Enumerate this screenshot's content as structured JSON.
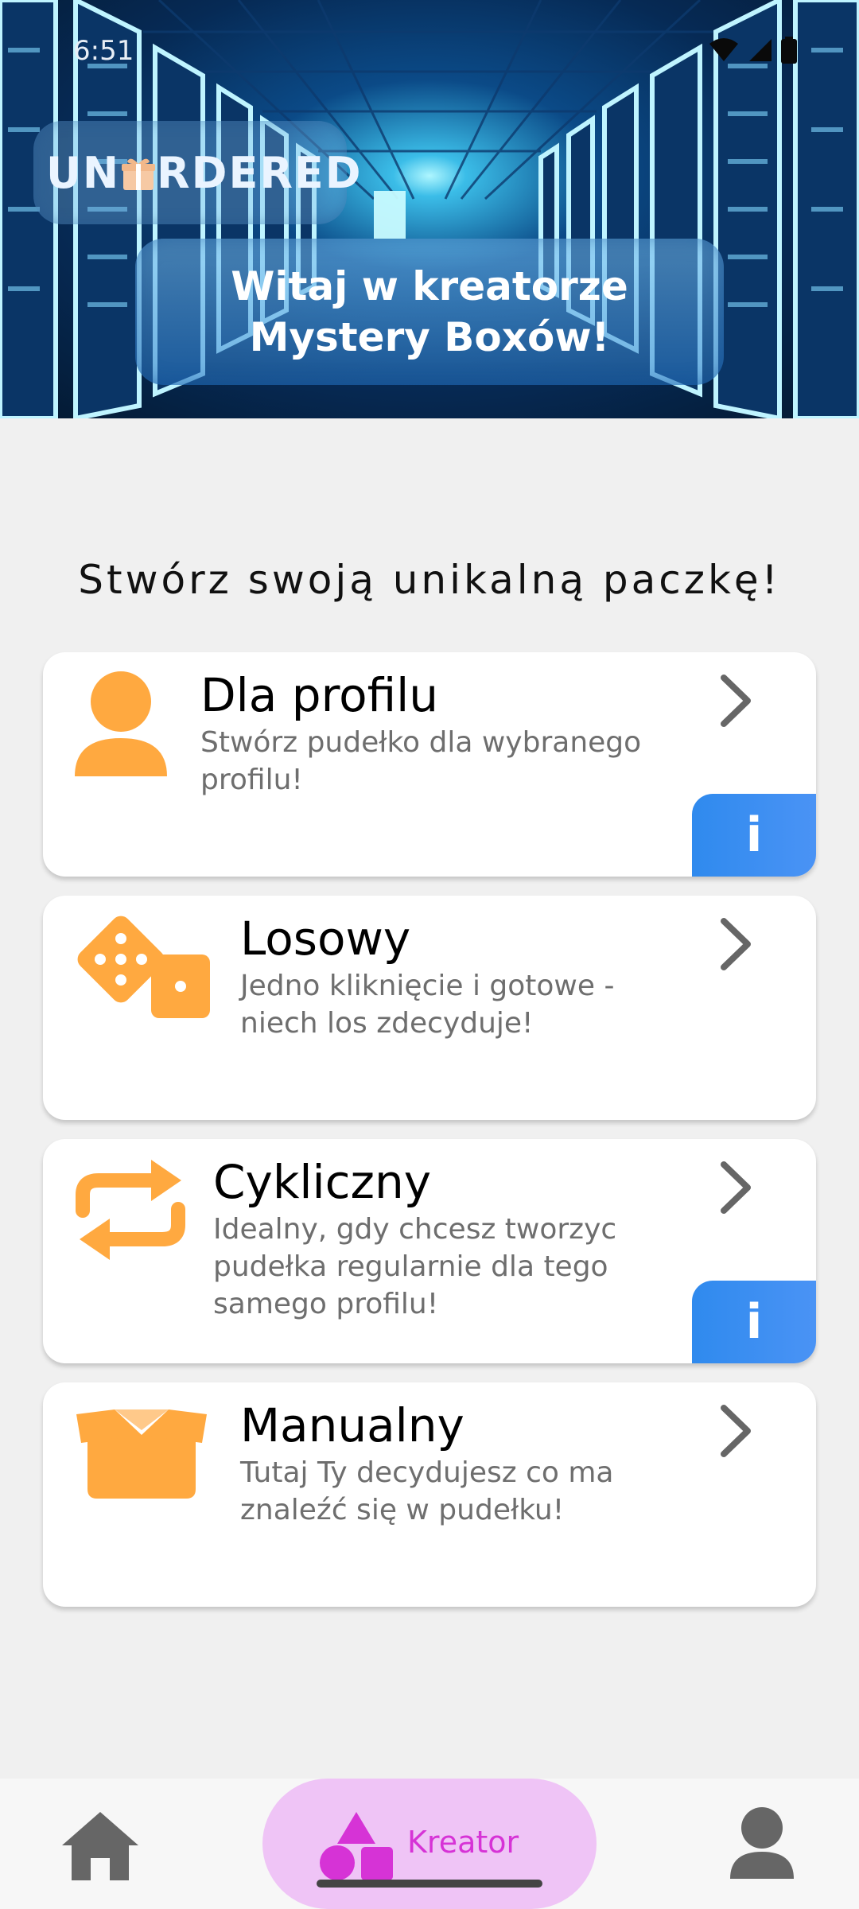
{
  "status_bar": {
    "time": "6:51"
  },
  "header": {
    "logo_text_left": "UN",
    "logo_text_right": "RDERED",
    "welcome": "Witaj w kreatorze Mystery Boxów!"
  },
  "main": {
    "subtitle": "Stwórz swoją unikalną paczkę!",
    "cards": [
      {
        "title": "Dla profilu",
        "description": "Stwórz pudełko dla wybranego profilu!",
        "icon": "person-icon",
        "info": "i"
      },
      {
        "title": "Losowy",
        "description": "Jedno kliknięcie i gotowe - niech los zdecyduje!",
        "icon": "dice-icon"
      },
      {
        "title": "Cykliczny",
        "description": "Idealny, gdy chcesz tworzyc pudełka regularnie dla tego samego profilu!",
        "icon": "repeat-icon",
        "info": "i"
      },
      {
        "title": "Manualny",
        "description": "Tutaj Ty decydujesz co ma znaleźć się w pudełku!",
        "icon": "open-box-icon"
      }
    ]
  },
  "bottom_nav": {
    "active_label": "Kreator"
  },
  "colors": {
    "accent_orange": "#ffa940",
    "info_blue": "#3b8ff0",
    "nav_active_bg": "#efc4f6",
    "nav_active_fg": "#d633d6",
    "icon_gray": "#666666"
  }
}
